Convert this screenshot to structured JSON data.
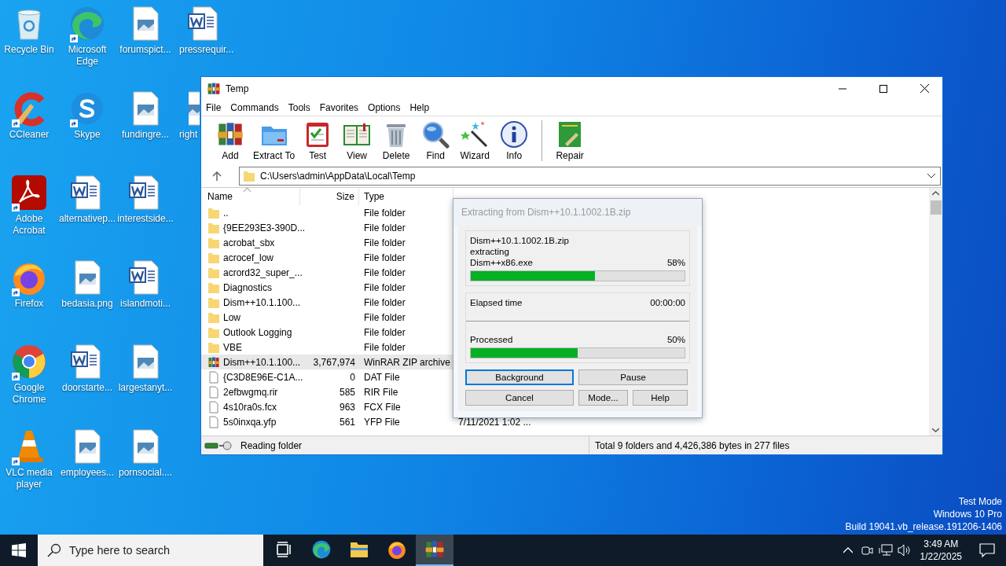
{
  "desktop": {
    "icons": [
      {
        "label": "Recycle Bin",
        "kind": "recycle",
        "shortcut": false
      },
      {
        "label": "CCleaner",
        "kind": "ccleaner",
        "shortcut": true
      },
      {
        "label": "Adobe Acrobat",
        "kind": "acrobat",
        "shortcut": true
      },
      {
        "label": "Firefox",
        "kind": "firefox",
        "shortcut": true
      },
      {
        "label": "Google Chrome",
        "kind": "chrome",
        "shortcut": true
      },
      {
        "label": "VLC media player",
        "kind": "vlc",
        "shortcut": true
      },
      {
        "label": "Microsoft Edge",
        "kind": "edge",
        "shortcut": true
      },
      {
        "label": "Skype",
        "kind": "skype",
        "shortcut": true
      },
      {
        "label": "alternativep...",
        "kind": "word",
        "shortcut": false
      },
      {
        "label": "bedasia.png",
        "kind": "image",
        "shortcut": false
      },
      {
        "label": "doorstarte...",
        "kind": "word",
        "shortcut": false
      },
      {
        "label": "employees...",
        "kind": "image",
        "shortcut": false
      },
      {
        "label": "forumspict...",
        "kind": "image",
        "shortcut": false
      },
      {
        "label": "fundingre...",
        "kind": "image",
        "shortcut": false
      },
      {
        "label": "interestside...",
        "kind": "word",
        "shortcut": false
      },
      {
        "label": "islandmoti...",
        "kind": "word",
        "shortcut": false
      },
      {
        "label": "largestanyt...",
        "kind": "image",
        "shortcut": false
      },
      {
        "label": "pornsocial....",
        "kind": "image",
        "shortcut": false
      },
      {
        "label": "pressrequir...",
        "kind": "word",
        "shortcut": false
      },
      {
        "label": "right",
        "kind": "image",
        "shortcut": false
      }
    ],
    "os_info": [
      "Test Mode",
      "Windows 10 Pro",
      "Build 19041.vb_release.191206-1406"
    ]
  },
  "window": {
    "title": "Temp",
    "menu": [
      "File",
      "Commands",
      "Tools",
      "Favorites",
      "Options",
      "Help"
    ],
    "toolbar": [
      {
        "label": "Add",
        "kind": "add"
      },
      {
        "label": "Extract To",
        "kind": "extract"
      },
      {
        "label": "Test",
        "kind": "test"
      },
      {
        "label": "View",
        "kind": "view"
      },
      {
        "label": "Delete",
        "kind": "delete"
      },
      {
        "label": "Find",
        "kind": "find"
      },
      {
        "label": "Wizard",
        "kind": "wizard"
      },
      {
        "label": "Info",
        "kind": "info"
      },
      {
        "label": "Repair",
        "kind": "repair"
      }
    ],
    "address": "C:\\Users\\admin\\AppData\\Local\\Temp",
    "columns": [
      "Name",
      "Size",
      "Type"
    ],
    "rows": [
      {
        "name": "..",
        "size": "",
        "type": "File folder",
        "kind": "folder",
        "selected": false
      },
      {
        "name": "{9EE293E3-390D...",
        "size": "",
        "type": "File folder",
        "kind": "folder",
        "selected": false
      },
      {
        "name": "acrobat_sbx",
        "size": "",
        "type": "File folder",
        "kind": "folder",
        "selected": false
      },
      {
        "name": "acrocef_low",
        "size": "",
        "type": "File folder",
        "kind": "folder",
        "selected": false
      },
      {
        "name": "acrord32_super_...",
        "size": "",
        "type": "File folder",
        "kind": "folder",
        "selected": false
      },
      {
        "name": "Diagnostics",
        "size": "",
        "type": "File folder",
        "kind": "folder",
        "selected": false
      },
      {
        "name": "Dism++10.1.100...",
        "size": "",
        "type": "File folder",
        "kind": "folder",
        "selected": false
      },
      {
        "name": "Low",
        "size": "",
        "type": "File folder",
        "kind": "folder",
        "selected": false
      },
      {
        "name": "Outlook Logging",
        "size": "",
        "type": "File folder",
        "kind": "folder",
        "selected": false
      },
      {
        "name": "VBE",
        "size": "",
        "type": "File folder",
        "kind": "folder",
        "selected": false
      },
      {
        "name": "Dism++10.1.100...",
        "size": "3,767,974",
        "type": "WinRAR ZIP archive",
        "kind": "archive",
        "selected": true
      },
      {
        "name": "{C3D8E96E-C1A...",
        "size": "0",
        "type": "DAT File",
        "kind": "file",
        "selected": false
      },
      {
        "name": "2efbwgmq.rir",
        "size": "585",
        "type": "RIR File",
        "kind": "file",
        "selected": false
      },
      {
        "name": "4s10ra0s.fcx",
        "size": "963",
        "type": "FCX File",
        "kind": "file",
        "selected": false
      },
      {
        "name": "5s0inxqa.yfp",
        "size": "561",
        "type": "YFP File",
        "kind": "file",
        "selected": false,
        "modified": "7/11/2021 1:02 ..."
      }
    ],
    "status_left": "Reading folder",
    "status_right": "Total 9 folders and 4,426,386 bytes in 277 files"
  },
  "dialog": {
    "title": "Extracting from Dism++10.1.1002.1B.zip",
    "archive": "Dism++10.1.1002.1B.zip",
    "action": "extracting",
    "file": "Dism++x86.exe",
    "file_percent": "58%",
    "file_bar": {
      "level": 0.58
    },
    "elapsed_label": "Elapsed time",
    "elapsed": "00:00:00",
    "processed_label": "Processed",
    "processed_percent": "50%",
    "processed_bar": {
      "level": 0.5
    },
    "buttons": [
      {
        "label": "Background",
        "focused": true
      },
      {
        "label": "Pause",
        "focused": false
      },
      {
        "label": "Cancel",
        "focused": false
      },
      {
        "label": "Mode...",
        "focused": false
      },
      {
        "label": "Help",
        "focused": false
      }
    ]
  },
  "taskbar": {
    "search_placeholder": "Type here to search",
    "apps": [
      {
        "kind": "taskview",
        "active": false
      },
      {
        "kind": "edge",
        "active": false
      },
      {
        "kind": "explorer",
        "active": false
      },
      {
        "kind": "firefox",
        "active": false
      },
      {
        "kind": "winrar",
        "active": true
      }
    ],
    "time": "3:49 AM",
    "date": "1/22/2025"
  }
}
